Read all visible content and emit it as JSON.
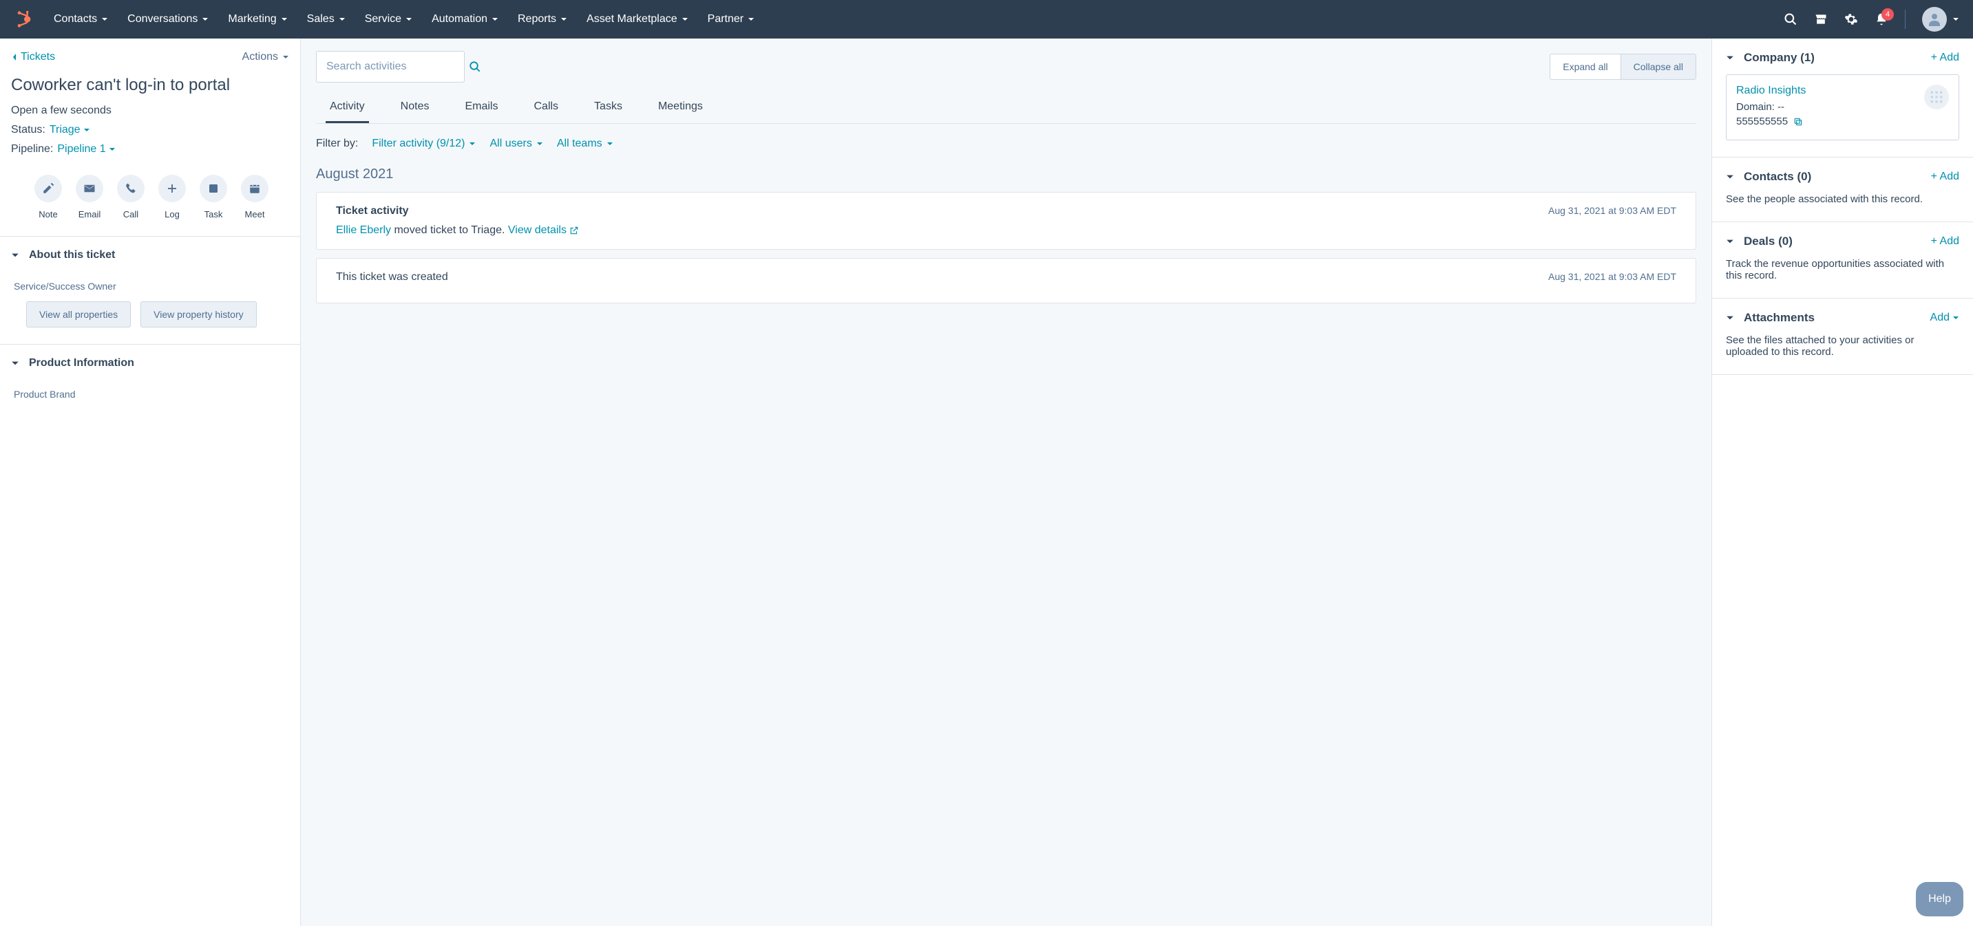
{
  "nav": {
    "items": [
      "Contacts",
      "Conversations",
      "Marketing",
      "Sales",
      "Service",
      "Automation",
      "Reports",
      "Asset Marketplace",
      "Partner"
    ],
    "notification_count": "4"
  },
  "left": {
    "back_label": "Tickets",
    "actions_label": "Actions",
    "title": "Coworker can't log-in to portal",
    "open_status": "Open a few seconds",
    "status_label": "Status:",
    "status_value": "Triage",
    "pipeline_label": "Pipeline:",
    "pipeline_value": "Pipeline 1",
    "actions": [
      {
        "label": "Note"
      },
      {
        "label": "Email"
      },
      {
        "label": "Call"
      },
      {
        "label": "Log"
      },
      {
        "label": "Task"
      },
      {
        "label": "Meet"
      }
    ],
    "about_section": "About this ticket",
    "owner_label": "Service/Success Owner",
    "view_all_props": "View all properties",
    "view_history": "View property history",
    "product_section": "Product Information",
    "product_brand_label": "Product Brand"
  },
  "center": {
    "search_placeholder": "Search activities",
    "expand_label": "Expand all",
    "collapse_label": "Collapse all",
    "tabs": [
      "Activity",
      "Notes",
      "Emails",
      "Calls",
      "Tasks",
      "Meetings"
    ],
    "filter_by_label": "Filter by:",
    "filter_activity": "Filter activity (9/12)",
    "filter_users": "All users",
    "filter_teams": "All teams",
    "month": "August 2021",
    "cards": [
      {
        "title": "Ticket activity",
        "date": "Aug 31, 2021 at 9:03 AM EDT",
        "actor": "Ellie Eberly",
        "action_text": " moved ticket to Triage. ",
        "link_text": "View details"
      },
      {
        "body": "This ticket was created",
        "date": "Aug 31, 2021 at 9:03 AM EDT"
      }
    ]
  },
  "right": {
    "add_label": "+ Add",
    "add_plain": "Add",
    "company": {
      "title": "Company (1)",
      "name": "Radio Insights",
      "domain_label": "Domain: --",
      "phone": "555555555"
    },
    "contacts": {
      "title": "Contacts (0)",
      "desc": "See the people associated with this record."
    },
    "deals": {
      "title": "Deals (0)",
      "desc": "Track the revenue opportunities associated with this record."
    },
    "attachments": {
      "title": "Attachments",
      "desc": "See the files attached to your activities or uploaded to this record."
    }
  },
  "help_label": "Help"
}
